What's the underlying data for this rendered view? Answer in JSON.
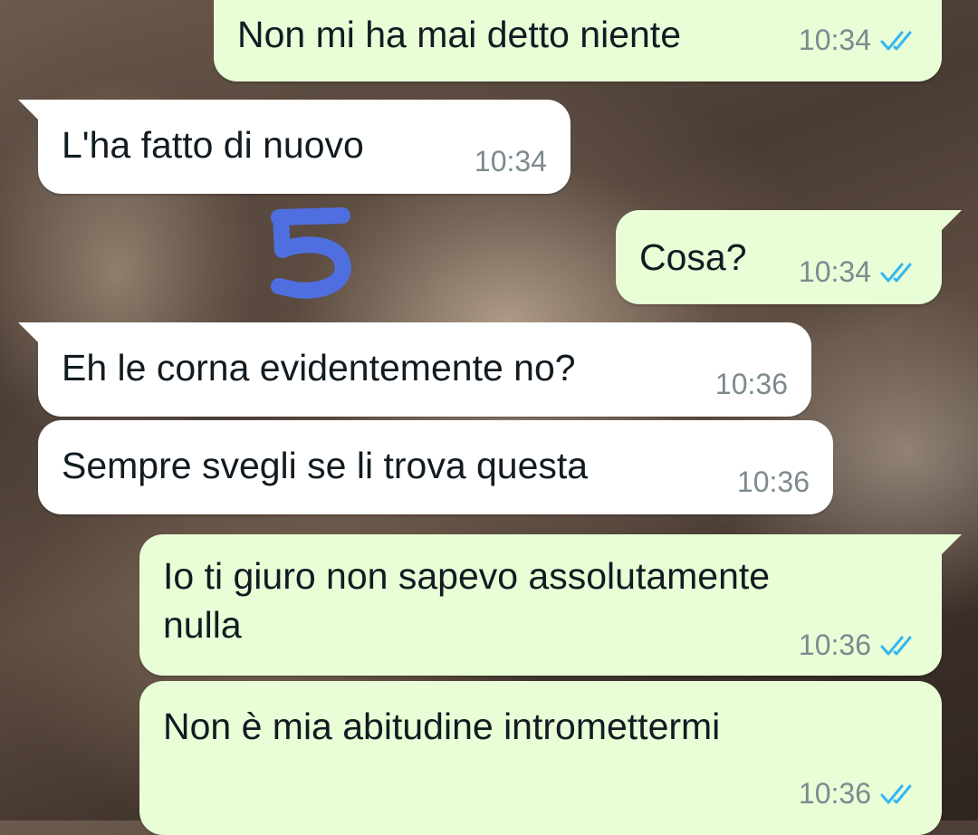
{
  "colors": {
    "incoming_bubble": "#ffffff",
    "outgoing_bubble": "#e9fdd7",
    "text": "#111b21",
    "timestamp": "#7d8a8f",
    "read_ticks": "#34b7f1",
    "sticker_number": "#4f6fe0"
  },
  "sticker": {
    "text": "5",
    "icon": "handwritten-number-5"
  },
  "messages": [
    {
      "direction": "out",
      "text": "Non mi ha mai detto niente",
      "time": "10:34",
      "status_icon": "double-check-read-icon"
    },
    {
      "direction": "in",
      "text": "L'ha fatto di nuovo",
      "time": "10:34"
    },
    {
      "direction": "out",
      "text": "Cosa?",
      "time": "10:34",
      "status_icon": "double-check-read-icon"
    },
    {
      "direction": "in",
      "text": "Eh le corna evidentemente no?",
      "time": "10:36"
    },
    {
      "direction": "in",
      "text": "Sempre svegli se li trova questa",
      "time": "10:36"
    },
    {
      "direction": "out",
      "text_line1": "Io ti giuro non sapevo assolutamente",
      "text_line2": "nulla",
      "time": "10:36",
      "status_icon": "double-check-read-icon"
    },
    {
      "direction": "out",
      "text": "Non è mia abitudine intromettermi",
      "time": "10:36",
      "status_icon": "double-check-read-icon"
    }
  ]
}
